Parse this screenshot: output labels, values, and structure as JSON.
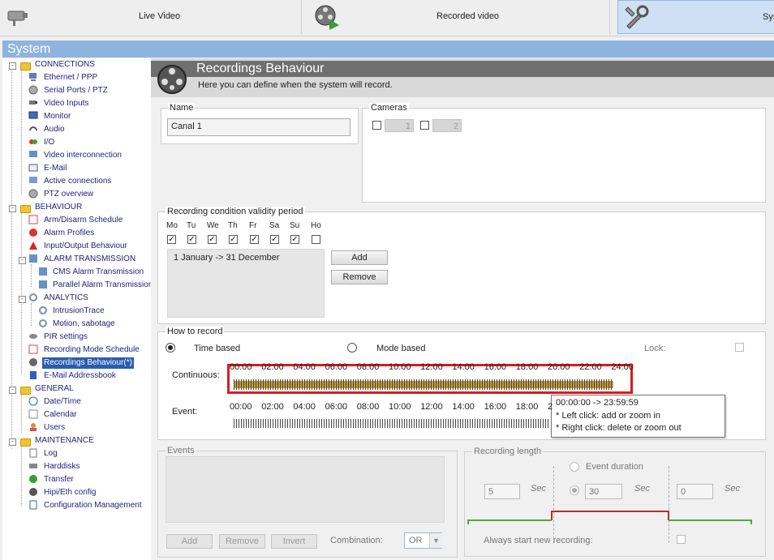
{
  "topbar": {
    "live_label": "Live Video",
    "recorded_label": "Recorded video",
    "system_label": "Sys"
  },
  "system_title": "System",
  "tree": {
    "connections": "CONNECTIONS",
    "ethernet": "Ethernet / PPP",
    "serial": "Serial Ports / PTZ",
    "video_inputs": "Video Inputs",
    "monitor": "Monitor",
    "audio": "Audio",
    "io": "I/O",
    "video_interconnection": "Video interconnection",
    "email": "E-Mail",
    "active_connections": "Active connections",
    "ptz_overview": "PTZ overview",
    "behaviour": "BEHAVIOUR",
    "arm_disarm": "Arm/Disarm Schedule",
    "alarm_profiles": "Alarm Profiles",
    "io_behaviour": "Input/Output Behaviour",
    "alarm_transmission": "ALARM TRANSMISSION",
    "cms_alarm": "CMS Alarm Transmission",
    "parallel_alarm": "Parallel Alarm Transmission",
    "analytics": "ANALYTICS",
    "intrusiontrace": "IntrusionTrace",
    "motion_sabotage": "Motion, sabotage",
    "pir": "PIR settings",
    "rec_mode_schedule": "Recording Mode Schedule",
    "rec_behaviour": "Recordings Behaviour(*)",
    "email_book": "E-Mail Addressbook",
    "general": "GENERAL",
    "datetime": "Date/Time",
    "calendar": "Calendar",
    "users": "Users",
    "maintenance": "MAINTENANCE",
    "log": "Log",
    "harddisks": "Harddisks",
    "transfer": "Transfer",
    "hipi": "Hipi/Eth config",
    "config_mgmt": "Configuration Management"
  },
  "main": {
    "title": "Recordings Behaviour",
    "subtitle": "Here you can define when the system will record.",
    "name_legend": "Name",
    "name_value": "Canal 1",
    "cameras_legend": "Cameras",
    "camera1": "1",
    "camera2": "2",
    "validity_legend": "Recording condition validity period",
    "days": [
      "Mo",
      "Tu",
      "We",
      "Th",
      "Fr",
      "Sa",
      "Su",
      "Ho"
    ],
    "days_checked": [
      true,
      true,
      true,
      true,
      true,
      true,
      true,
      false
    ],
    "period": "1 January -> 31 December",
    "add": "Add",
    "remove": "Remove",
    "how_legend": "How to record",
    "time_based": "Time based",
    "mode_based": "Mode based",
    "lock": "Lock:",
    "continuous": "Continuous:",
    "event": "Event:",
    "hours": [
      "00:00",
      "02:00",
      "04:00",
      "06:00",
      "08:00",
      "10:00",
      "12:00",
      "14:00",
      "16:00",
      "18:00",
      "20:00",
      "22:00",
      "24:00"
    ],
    "event_hours": [
      "00:00",
      "02:00",
      "04:00",
      "06:00",
      "08:00",
      "10:00",
      "12:00",
      "14:00",
      "16:00",
      "18:00",
      "2"
    ],
    "tooltip": {
      "line1": "00:00:00 -> 23:59:59",
      "line2": "* Left click: add or zoom in",
      "line3": "* Right click: delete or zoom out"
    },
    "events_legend": "Events",
    "events_add": "Add",
    "events_remove": "Remove",
    "events_invert": "Invert",
    "combination": "Combination:",
    "combination_value": "OR",
    "rec_length_legend": "Recording length",
    "event_duration": "Event duration",
    "pre_value": "5",
    "during_value": "30",
    "post_value": "0",
    "sec": "Sec",
    "always_new": "Always start new recording:"
  },
  "colors": {
    "accent": "#8eb3de",
    "selection": "#2a5db0",
    "highlight_border": "#e0191f",
    "timeline_fill": "#c89a32"
  }
}
